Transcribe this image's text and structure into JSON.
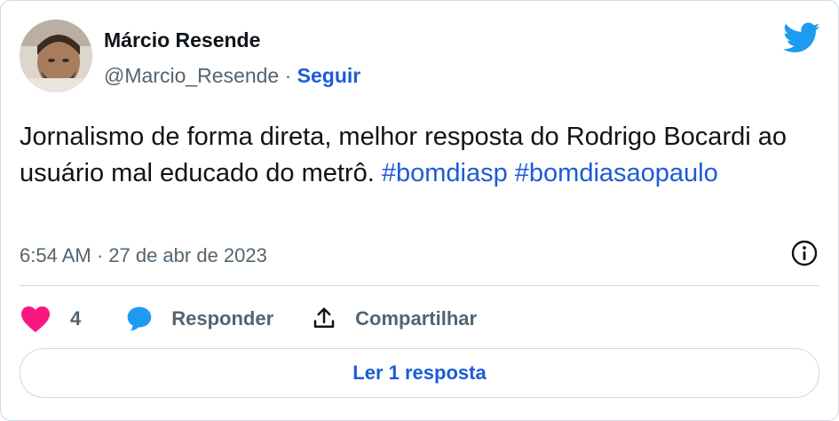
{
  "tweet": {
    "author_name": "Márcio Resende",
    "handle": "@Marcio_Resende",
    "separator": "·",
    "follow_label": "Seguir",
    "text_main": "Jornalismo de forma direta, melhor resposta do Rodrigo Bocardi ao usuário mal educado do metrô. ",
    "hashtags": [
      "#bomdiasp",
      "#bomdiasaopaulo"
    ],
    "timestamp": "6:54 AM · 27 de abr de 2023"
  },
  "actions": {
    "like_count": "4",
    "reply_label": "Responder",
    "share_label": "Compartilhar"
  },
  "read_replies_label": "Ler 1 resposta",
  "colors": {
    "twitter_blue": "#1d9bf0",
    "link_blue": "#1d5bd6",
    "heart": "#f91880",
    "muted": "#536471",
    "border": "#cfd9de"
  },
  "icons": [
    "twitter-bird-icon",
    "info-icon",
    "heart-icon",
    "reply-bubble-icon",
    "share-icon"
  ]
}
